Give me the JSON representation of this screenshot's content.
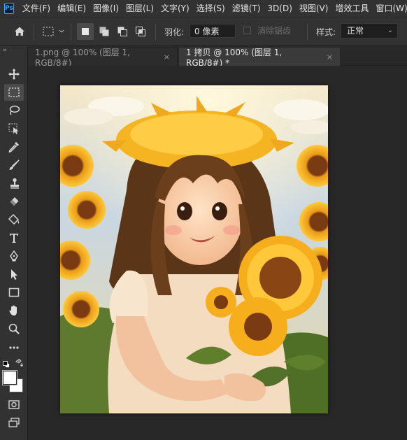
{
  "app": {
    "logo_text": "Ps"
  },
  "menu": [
    "文件(F)",
    "编辑(E)",
    "图像(I)",
    "图层(L)",
    "文字(Y)",
    "选择(S)",
    "滤镜(T)",
    "3D(D)",
    "视图(V)",
    "增效工具",
    "窗口(W)"
  ],
  "options": {
    "feather_label": "羽化:",
    "feather_value": "0 像素",
    "anti_alias_label": "消除锯齿",
    "style_label": "样式:",
    "style_value": "正常"
  },
  "tabs": [
    {
      "label": "1.png @ 100% (图层 1, RGB/8#)",
      "close": "×"
    },
    {
      "label": "1 拷贝 @ 100% (图层 1, RGB/8#) *",
      "close": "×"
    }
  ],
  "toolbar": {
    "grip": "»",
    "tools": [
      "move-tool",
      "marquee-tool",
      "lasso-tool",
      "object-select-tool",
      "eyedropper-tool",
      "brush-tool",
      "clone-stamp-tool",
      "eraser-tool",
      "paint-bucket-tool",
      "type-tool",
      "pen-tool",
      "path-select-tool",
      "rectangle-tool",
      "hand-tool",
      "zoom-tool",
      "more-tools",
      "swap-colors",
      "foreground-color",
      "quick-mask",
      "screen-mode"
    ]
  },
  "colors": {
    "accent": "#31a8ff",
    "panel": "#323232",
    "workspace": "#282828"
  }
}
